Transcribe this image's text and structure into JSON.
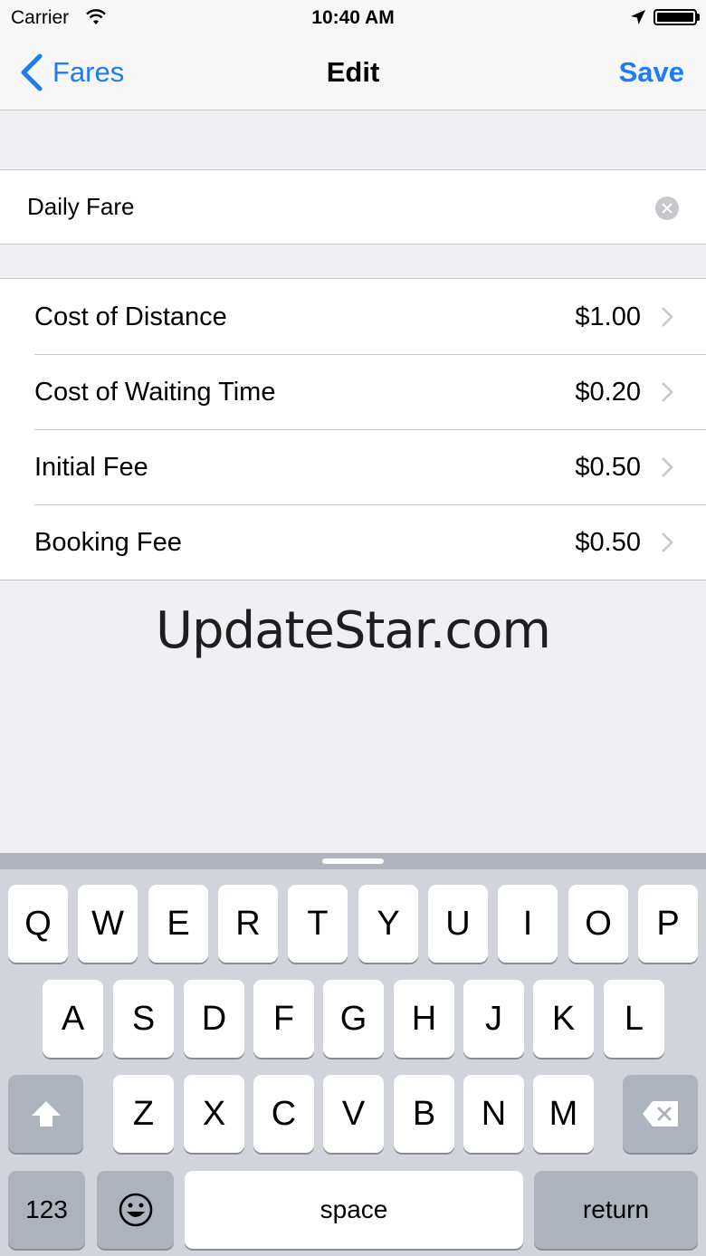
{
  "status_bar": {
    "carrier": "Carrier",
    "time": "10:40 AM",
    "battery_level": 1.0,
    "icons": [
      "wifi-icon",
      "location-arrow-icon",
      "battery-icon"
    ]
  },
  "nav": {
    "back_label": "Fares",
    "title": "Edit",
    "save_label": "Save"
  },
  "fare_name": {
    "value": "Daily Fare"
  },
  "fees": [
    {
      "label": "Cost of Distance",
      "value": "$1.00"
    },
    {
      "label": "Cost of Waiting Time",
      "value": "$0.20"
    },
    {
      "label": "Initial Fee",
      "value": "$0.50"
    },
    {
      "label": "Booking Fee",
      "value": "$0.50"
    }
  ],
  "watermark": "UpdateStar.com",
  "keyboard": {
    "row1": [
      "Q",
      "W",
      "E",
      "R",
      "T",
      "Y",
      "U",
      "I",
      "O",
      "P"
    ],
    "row2": [
      "A",
      "S",
      "D",
      "F",
      "G",
      "H",
      "J",
      "K",
      "L"
    ],
    "row3": [
      "Z",
      "X",
      "C",
      "V",
      "B",
      "N",
      "M"
    ],
    "numbers_label": "123",
    "space_label": "space",
    "return_label": "return"
  },
  "colors": {
    "accent": "#1b7cf5",
    "background": "#efeff4",
    "keyboard": "#d1d5db"
  }
}
